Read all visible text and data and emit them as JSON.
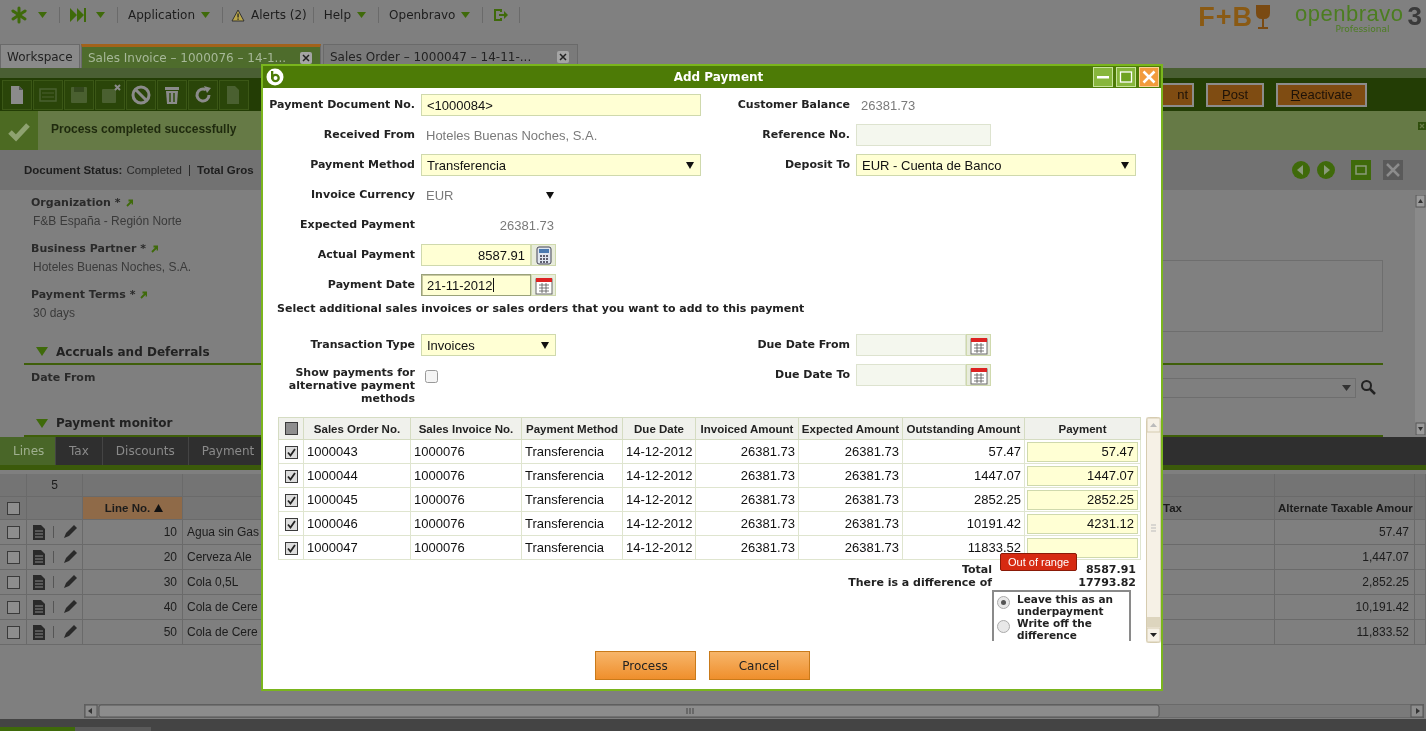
{
  "top_menu": [
    {
      "label": "Application",
      "kind": "dropdown"
    },
    {
      "label": "Alerts (2)",
      "kind": "alerts"
    },
    {
      "label": "Help",
      "kind": "dropdown"
    },
    {
      "label": "Openbravo",
      "kind": "dropdown"
    }
  ],
  "brand": {
    "partner": "F+B",
    "product": "openbravo",
    "edition": "Professional",
    "version": "3"
  },
  "window_tabs": [
    {
      "label": "Workspace",
      "selected": false,
      "closable": false
    },
    {
      "label": "Sales Invoice – 1000076 – 14-1...",
      "selected": true,
      "closable": true
    },
    {
      "label": "Sales Order – 1000047 – 14-11-...",
      "selected": false,
      "closable": true
    }
  ],
  "process_buttons": [
    {
      "label": "nt",
      "underline_first": false
    },
    {
      "label": "Post",
      "underline_first": true
    },
    {
      "label": "Reactivate",
      "underline_first": true
    }
  ],
  "message": {
    "kind": "success",
    "text": "Process completed successfully"
  },
  "status_line": [
    {
      "label": "Document Status:",
      "value": "Completed"
    },
    {
      "label": "Total Gros"
    }
  ],
  "header_fields": [
    {
      "label": "Organization *",
      "value": "F&B España - Región Norte"
    },
    {
      "label": "Business Partner *",
      "value": "Hoteles Buenas Noches, S.A."
    },
    {
      "label": "Payment Terms *",
      "value": "30 days"
    }
  ],
  "sections": [
    {
      "title": "Accruals and Deferrals",
      "expanded": true,
      "fields": [
        {
          "label": "Date From"
        }
      ]
    },
    {
      "title": "Payment monitor",
      "expanded": true
    }
  ],
  "line_tabs": [
    {
      "label": "Lines",
      "selected": true
    },
    {
      "label": "Tax",
      "selected": false
    },
    {
      "label": "Discounts",
      "selected": false
    },
    {
      "label": "Payment",
      "selected": false
    }
  ],
  "lines_grid": {
    "record_count": "5",
    "all_selected": false,
    "columns": [
      {
        "label": "Line No.",
        "sort_ascending": true
      },
      {
        "label": "Tax"
      },
      {
        "label": "Alternate Taxable Amour"
      }
    ],
    "rows": [
      {
        "selected": false,
        "line_no": "10",
        "product": "Agua sin Gas",
        "alternate_taxable_amount": "57.47"
      },
      {
        "selected": false,
        "line_no": "20",
        "product": "Cerveza Ale",
        "alternate_taxable_amount": "1,447.07"
      },
      {
        "selected": false,
        "line_no": "30",
        "product": "Cola 0,5L",
        "alternate_taxable_amount": "2,852.25"
      },
      {
        "selected": false,
        "line_no": "40",
        "product": "Cola de Cere",
        "alternate_taxable_amount": "10,191.42"
      },
      {
        "selected": false,
        "line_no": "50",
        "product": "Cola de Cere",
        "alternate_taxable_amount": "11,833.52"
      }
    ]
  },
  "dialog": {
    "title": "Add Payment",
    "form_rows": [
      {
        "left": {
          "label": "Payment Document No.",
          "value": "<1000084>",
          "kind": "text"
        },
        "right": {
          "label": "Customer Balance",
          "value": "26381.73",
          "kind": "readonly"
        }
      },
      {
        "left": {
          "label": "Received From",
          "value": "Hoteles Buenas Noches, S.A.",
          "kind": "readonly"
        },
        "right": {
          "label": "Reference No.",
          "kind": "disabled"
        }
      },
      {
        "left": {
          "label": "Payment Method",
          "value": "Transferencia",
          "kind": "select"
        },
        "right": {
          "label": "Deposit To",
          "value": "EUR - Cuenta de Banco",
          "kind": "select"
        }
      },
      {
        "left": {
          "label": "Invoice Currency",
          "value": "EUR",
          "kind": "readonly-select"
        }
      },
      {
        "left": {
          "label": "Expected Payment",
          "value": "26381.73",
          "kind": "readonly-number"
        }
      },
      {
        "left": {
          "label": "Actual Payment",
          "value": "8587.91",
          "kind": "calculator"
        }
      },
      {
        "left": {
          "label": "Payment Date",
          "value": "21-11-2012",
          "kind": "date",
          "focused": true
        }
      }
    ],
    "instruction": "Select additional sales invoices or sales orders that you want to add to this payment",
    "filter_rows": [
      {
        "left": {
          "label": "Transaction Type",
          "value": "Invoices",
          "kind": "compact-select"
        },
        "right": {
          "label": "Due Date From",
          "kind": "date",
          "focused": false
        }
      },
      {
        "left": {
          "label": "Show payments for alternative payment methods",
          "kind": "checkbox",
          "checked": false
        },
        "right": {
          "label": "Due Date To",
          "kind": "date",
          "focused": false
        }
      }
    ],
    "grid": {
      "all_selected": false,
      "columns": [
        "Sales Order No.",
        "Sales Invoice No.",
        "Payment Method",
        "Due Date",
        "Invoiced Amount",
        "Expected Amount",
        "Outstanding Amount",
        "Payment"
      ],
      "rows": [
        {
          "selected": true,
          "cells": [
            "1000043",
            "1000076",
            "Transferencia",
            "14-12-2012",
            "26381.73",
            "26381.73",
            "57.47"
          ],
          "payment": "57.47"
        },
        {
          "selected": true,
          "cells": [
            "1000044",
            "1000076",
            "Transferencia",
            "14-12-2012",
            "26381.73",
            "26381.73",
            "1447.07"
          ],
          "payment": "1447.07"
        },
        {
          "selected": true,
          "cells": [
            "1000045",
            "1000076",
            "Transferencia",
            "14-12-2012",
            "26381.73",
            "26381.73",
            "2852.25"
          ],
          "payment": "2852.25"
        },
        {
          "selected": true,
          "cells": [
            "1000046",
            "1000076",
            "Transferencia",
            "14-12-2012",
            "26381.73",
            "26381.73",
            "10191.42"
          ],
          "payment": "4231.12"
        },
        {
          "selected": true,
          "cells": [
            "1000047",
            "1000076",
            "Transferencia",
            "14-12-2012",
            "26381.73",
            "26381.73",
            "11833.52"
          ],
          "error_message": "Out of range"
        }
      ]
    },
    "total_label": "Total",
    "total": "8587.91",
    "difference_label": "There is a difference of",
    "difference": "17793.82",
    "difference_options": [
      {
        "label": "Leave this as an underpayment",
        "selected": true
      },
      {
        "label": "Write off the difference",
        "selected": false
      }
    ],
    "buttons": [
      "Process",
      "Cancel"
    ]
  }
}
